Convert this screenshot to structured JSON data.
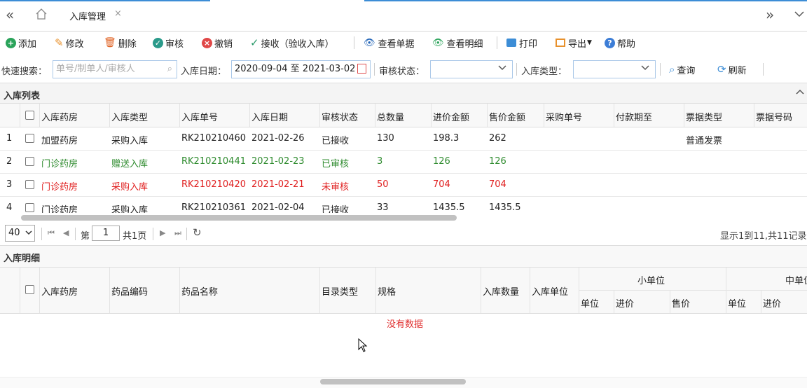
{
  "tabs": {
    "active_label": "入库管理",
    "close_glyph": "×",
    "home_icon": "home-icon",
    "nav_left_icon": "double-left-icon",
    "nav_right_icon": "double-right-icon",
    "dropdown_icon": "chevron-down-icon"
  },
  "toolbar": {
    "add": "添加",
    "edit": "修改",
    "delete": "删除",
    "audit": "审核",
    "revoke": "撤销",
    "receive": "接收（验收入库）",
    "view_doc": "查看单据",
    "view_detail": "查看明细",
    "print": "打印",
    "export": "导出",
    "help": "帮助"
  },
  "filters": {
    "quick_search_label": "快速搜索：",
    "quick_search_placeholder": "单号/制单人/审核人",
    "date_label": "入库日期：",
    "date_value": "2020-09-04 至 2021-03-02",
    "audit_status_label": "审核状态：",
    "audit_status_value": "",
    "type_label": "入库类型：",
    "type_value": "",
    "query": "查询",
    "refresh": "刷新"
  },
  "list_panel": {
    "title": "入库列表",
    "columns": [
      "入库药房",
      "入库类型",
      "入库单号",
      "入库日期",
      "审核状态",
      "总数量",
      "进价金额",
      "售价金额",
      "采购单号",
      "付款期至",
      "票据类型",
      "票据号码"
    ],
    "rows": [
      {
        "no": "1",
        "cells": [
          "加盟药房",
          "采购入库",
          "RK210210460",
          "2021-02-26",
          "已接收",
          "130",
          "198.3",
          "262",
          "",
          "",
          "普通发票",
          ""
        ],
        "color": "#222222"
      },
      {
        "no": "2",
        "cells": [
          "门诊药房",
          "赠送入库",
          "RK210210441",
          "2021-02-23",
          "已审核",
          "3",
          "126",
          "126",
          "",
          "",
          "",
          ""
        ],
        "color": "#2e8b2e"
      },
      {
        "no": "3",
        "cells": [
          "门诊药房",
          "采购入库",
          "RK210210420",
          "2021-02-21",
          "未审核",
          "50",
          "704",
          "704",
          "",
          "",
          "",
          ""
        ],
        "color": "#e02020"
      },
      {
        "no": "4",
        "cells": [
          "门诊药房",
          "采购入库",
          "RK210210361",
          "2021-02-04",
          "已接收",
          "33",
          "1435.5",
          "1435.5",
          "",
          "",
          "",
          ""
        ],
        "color": "#222222"
      }
    ]
  },
  "pager": {
    "page_size": "40",
    "page_prefix": "第",
    "page_value": "1",
    "page_total": "共1页",
    "summary": "显示1到11,共11记录"
  },
  "detail_panel": {
    "title": "入库明细",
    "columns": [
      "入库药房",
      "药品编码",
      "药品名称",
      "目录类型",
      "规格",
      "入库数量",
      "入库单位"
    ],
    "group_small": "小单位",
    "group_mid": "中单位",
    "small_sub": [
      "单位",
      "进价",
      "售价"
    ],
    "mid_sub": [
      "单位",
      "进价"
    ],
    "empty_text": "没有数据"
  },
  "colors": {
    "accent": "#3c8dd6",
    "approved": "#2e8b2e",
    "unapproved": "#e02020"
  }
}
